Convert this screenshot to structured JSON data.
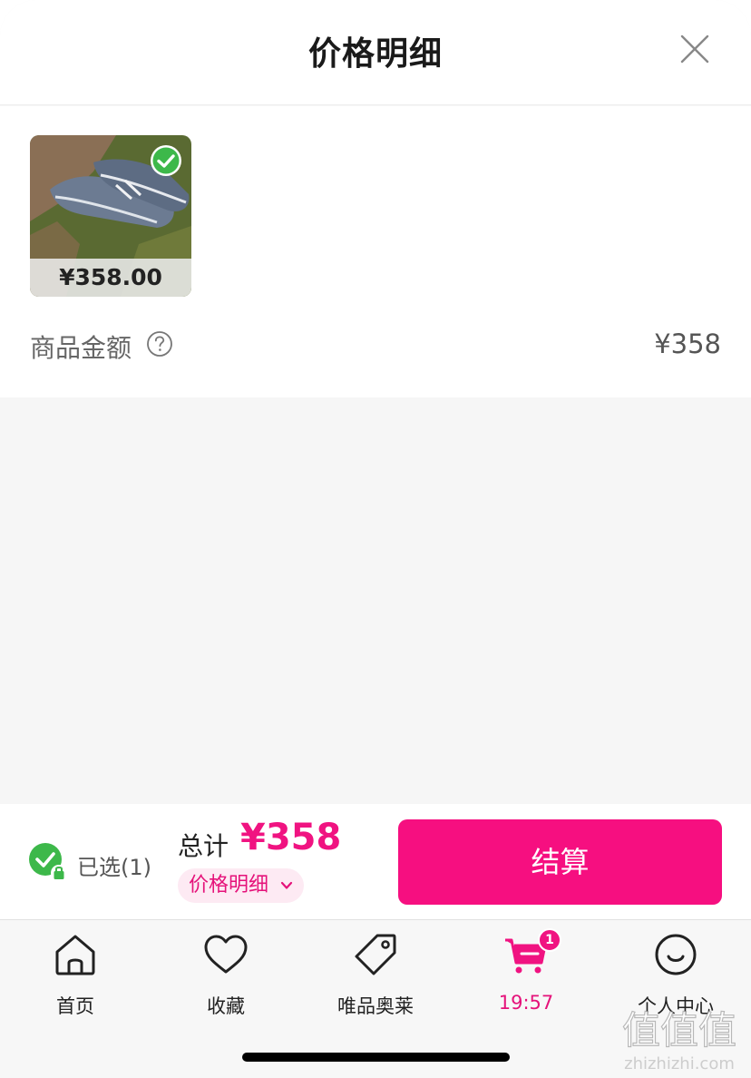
{
  "header": {
    "title": "价格明细"
  },
  "product": {
    "price_tag": "¥358.00",
    "selected": true
  },
  "summary": {
    "amount_label": "商品金额",
    "amount_value": "¥358"
  },
  "checkout": {
    "selected_text": "已选(1)",
    "total_label": "总计",
    "total_value": "¥358",
    "price_detail_label": "价格明细",
    "checkout_label": "结算"
  },
  "tabbar": {
    "items": [
      {
        "label": "首页",
        "icon": "home-icon"
      },
      {
        "label": "收藏",
        "icon": "heart-icon"
      },
      {
        "label": "唯品奥莱",
        "icon": "tag-icon"
      },
      {
        "label": "19:57",
        "icon": "cart-icon",
        "badge": "1",
        "active": true
      },
      {
        "label": "个人中心",
        "icon": "smiley-icon"
      }
    ]
  },
  "watermark": {
    "text": "zhizhizhi.com",
    "logo_text": "值值值"
  },
  "colors": {
    "accent": "#f60f80",
    "accent_text": "#e5127a",
    "check_green": "#3db84a"
  }
}
